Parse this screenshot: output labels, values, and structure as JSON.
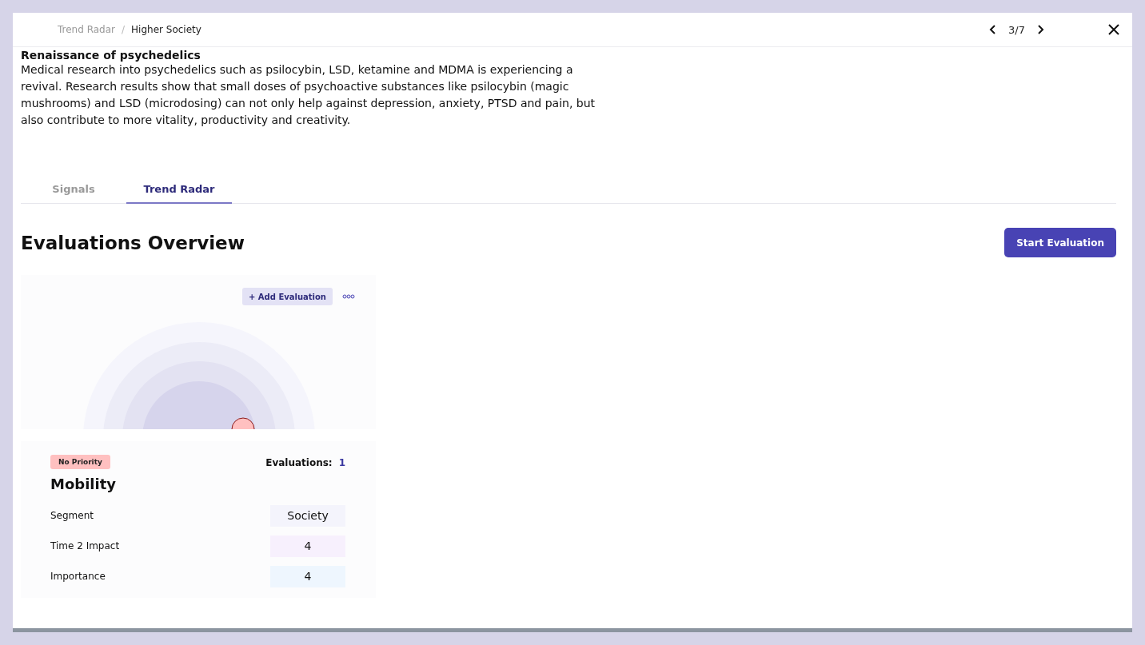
{
  "breadcrumb": [
    {
      "label": "Trend Radar",
      "current": false
    },
    {
      "label": "Higher Society",
      "current": true
    }
  ],
  "breadcrumb_separator": "/",
  "pager": {
    "position": "3/7"
  },
  "trend": {
    "title": "Renaissance of psychedelics",
    "description": "Medical research into psychedelics such as psilocybin, LSD, ketamine and MDMA is experiencing a revival. Research results show that small doses of psychoactive substances like psilocybin (magic mushrooms) and LSD (microdosing) can not only help against depression, anxiety, PTSD and pain, but also contribute to more vitality, productivity and creativity."
  },
  "tabs": [
    {
      "label": "Signals",
      "selected": false
    },
    {
      "label": "Trend Radar",
      "selected": true
    }
  ],
  "section": {
    "title": "Evaluations Overview",
    "action": "Start Evaluation"
  },
  "evaluation_card": {
    "add_button": "+ Add Evaluation",
    "priority": "No Priority",
    "evaluations_label": "Evaluations:",
    "evaluations_count": "1",
    "name": "Mobility",
    "rows": [
      {
        "label": "Segment",
        "value": "Society",
        "color": "#f4f4fc"
      },
      {
        "label": "Time 2 Impact",
        "value": "4",
        "color": "#f7f0fd"
      },
      {
        "label": "Importance",
        "value": "4",
        "color": "#eef6fe"
      }
    ]
  }
}
